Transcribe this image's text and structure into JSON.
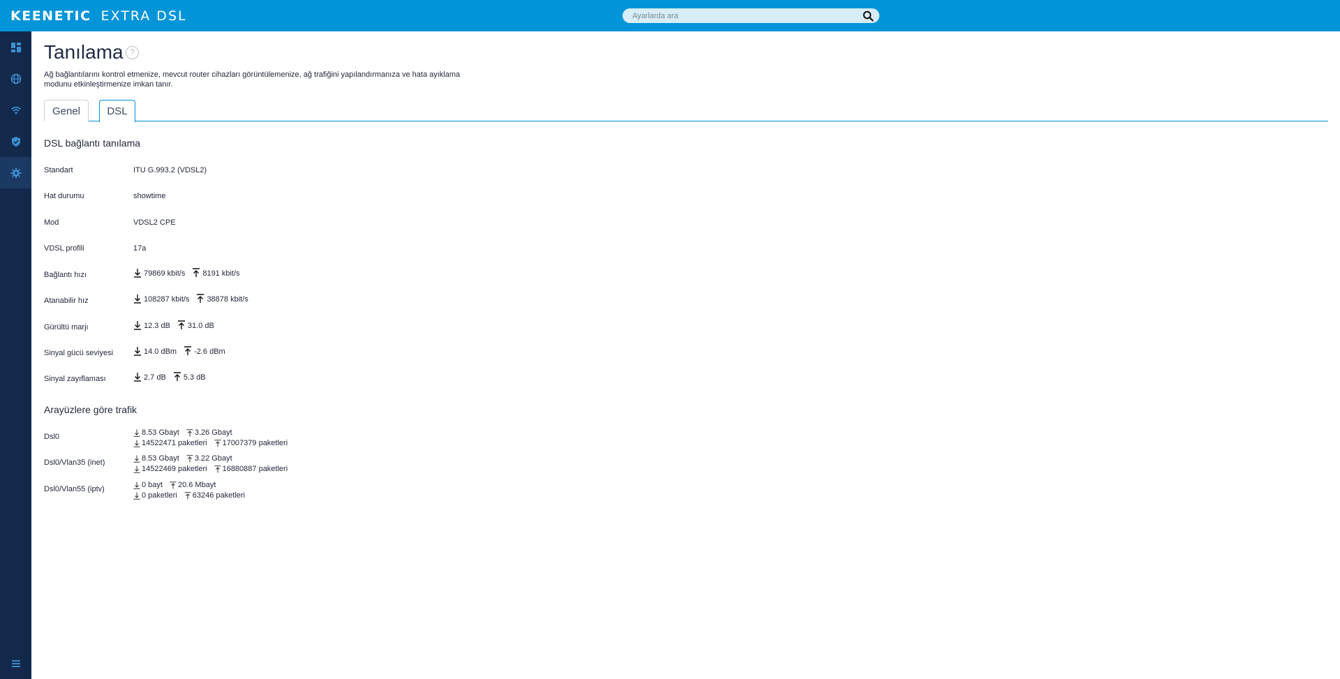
{
  "header": {
    "brand_name": "KEENETIC",
    "brand_model": "EXTRA DSL",
    "search_placeholder": "Ayarlarda ara"
  },
  "sidebar": {
    "items": [
      {
        "icon": "dashboard-icon",
        "active": false
      },
      {
        "icon": "globe-icon",
        "active": false
      },
      {
        "icon": "wifi-icon",
        "active": false
      },
      {
        "icon": "shield-icon",
        "active": false
      },
      {
        "icon": "gear-icon",
        "active": true
      }
    ],
    "bottom_icon": "menu-icon"
  },
  "page": {
    "title": "Tanılama",
    "description": "Ağ bağlantılarını kontrol etmenize, mevcut router cihazları görüntülemenize, ağ trafiğini yapılandırmanıza ve hata ayıklama modunu etkinleştirmenize imkan tanır.",
    "tabs": [
      {
        "label": "Genel",
        "active": false
      },
      {
        "label": "DSL",
        "active": true
      }
    ]
  },
  "dsl": {
    "section_title": "DSL bağlantı tanılama",
    "rows": [
      {
        "label": "Standart",
        "value": "ITU G.993.2 (VDSL2)"
      },
      {
        "label": "Hat durumu",
        "value": "showtime"
      },
      {
        "label": "Mod",
        "value": "VDSL2 CPE"
      },
      {
        "label": "VDSL profili",
        "value": "17a"
      },
      {
        "label": "Bağlantı hızı",
        "down": "79869 kbit/s",
        "up": "8191 kbit/s"
      },
      {
        "label": "Atanabilir hız",
        "down": "108287 kbit/s",
        "up": "38878 kbit/s"
      },
      {
        "label": "Gürültü marjı",
        "down": "12.3 dB",
        "up": "31.0 dB"
      },
      {
        "label": "Sinyal gücü seviyesi",
        "down": "14.0 dBm",
        "up": "-2.6 dBm"
      },
      {
        "label": "Sinyal zayıflaması",
        "down": "2.7 dB",
        "up": "5.3 dB"
      }
    ]
  },
  "traffic": {
    "section_title": "Arayüzlere göre trafik",
    "rows": [
      {
        "label": "Dsl0",
        "down_bytes": "8.53 Gbayt",
        "up_bytes": "3.26 Gbayt",
        "down_packets": "14522471 paketleri",
        "up_packets": "17007379 paketleri"
      },
      {
        "label": "Dsl0/Vlan35 (inet)",
        "down_bytes": "8.53 Gbayt",
        "up_bytes": "3.22 Gbayt",
        "down_packets": "14522469 paketleri",
        "up_packets": "16880887 paketleri"
      },
      {
        "label": "Dsl0/Vlan55 (iptv)",
        "down_bytes": "0 bayt",
        "up_bytes": "20.6 Mbayt",
        "down_packets": "0 paketleri",
        "up_packets": "63246 paketleri"
      }
    ]
  }
}
